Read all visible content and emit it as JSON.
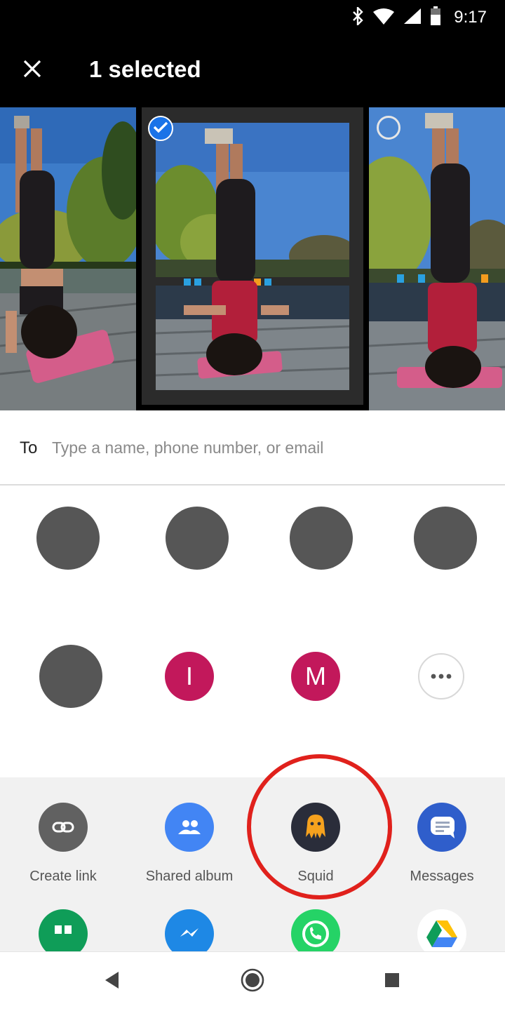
{
  "status_bar": {
    "time": "9:17",
    "icons": [
      "bluetooth-icon",
      "wifi-icon",
      "signal-icon",
      "battery-icon"
    ]
  },
  "app_bar": {
    "close_icon": "close-icon",
    "title": "1 selected"
  },
  "photos": [
    {
      "state": "unselected"
    },
    {
      "state": "selected"
    },
    {
      "state": "unselected"
    }
  ],
  "to_field": {
    "label": "To",
    "value": "",
    "placeholder": "Type a name, phone number, or email"
  },
  "contacts": [
    {
      "type": "photo"
    },
    {
      "type": "photo"
    },
    {
      "type": "photo"
    },
    {
      "type": "photo"
    },
    {
      "type": "photo"
    },
    {
      "type": "initial",
      "initial": "I"
    },
    {
      "type": "initial",
      "initial": "M"
    },
    {
      "type": "more",
      "icon": "more-icon"
    }
  ],
  "share_apps": [
    {
      "label": "Create link",
      "icon": "link-icon",
      "color": "#616161"
    },
    {
      "label": "Shared album",
      "icon": "people-icon",
      "color": "#4285f4"
    },
    {
      "label": "Squid",
      "icon": "squid-icon",
      "color": "#2a2d3a"
    },
    {
      "label": "Messages",
      "icon": "messages-icon",
      "color": "#2f5ecb"
    }
  ],
  "more_apps": [
    {
      "icon": "hangouts-icon",
      "color": "#0f9d58"
    },
    {
      "icon": "messenger-icon",
      "color": "#1e88e5"
    },
    {
      "icon": "whatsapp-icon",
      "color": "#25d366"
    },
    {
      "icon": "google-drive-icon",
      "color": "#ffffff"
    }
  ],
  "highlight_color": "#e0211c",
  "nav": {
    "back": "back-icon",
    "home": "home-icon",
    "recents": "recents-icon"
  }
}
